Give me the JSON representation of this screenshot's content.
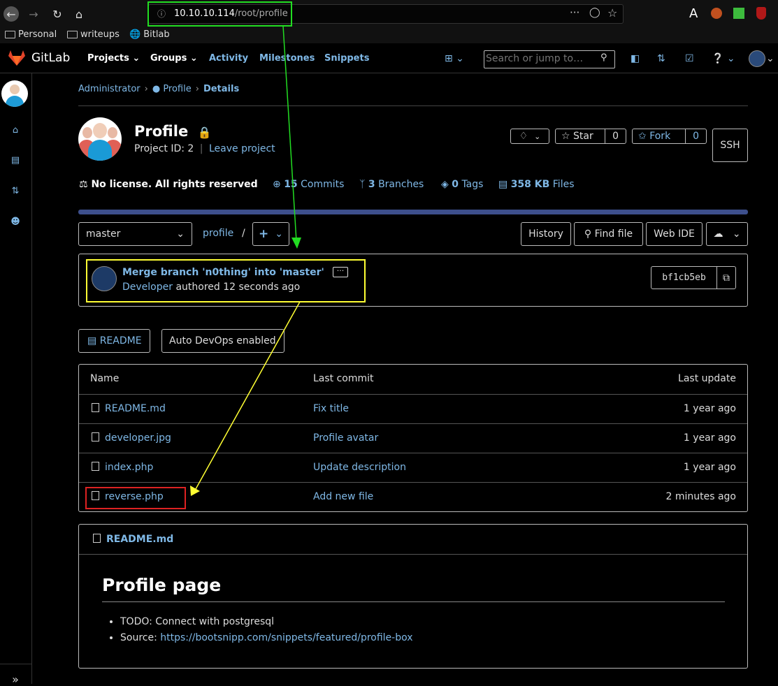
{
  "browser": {
    "url_host": "10.10.10.114",
    "url_path": "/root/profile",
    "bookmarks": [
      "Personal",
      "writeups",
      "Bitlab"
    ],
    "reader_letter": "A"
  },
  "gitlab_header": {
    "brand": "GitLab",
    "nav": [
      "Projects",
      "Groups",
      "Activity",
      "Milestones",
      "Snippets"
    ],
    "search_placeholder": "Search or jump to…"
  },
  "breadcrumb": {
    "items": [
      "Administrator",
      "Profile",
      "Details"
    ]
  },
  "project": {
    "title": "Profile",
    "project_id_label": "Project ID: 2",
    "leave_label": "Leave project",
    "star_label": "Star",
    "star_count": "0",
    "fork_label": "Fork",
    "fork_count": "0",
    "ssh_label": "SSH"
  },
  "stats": {
    "license": "No license. All rights reserved",
    "commits_count": "15",
    "commits_label": "Commits",
    "branches_count": "3",
    "branches_label": "Branches",
    "tags_count": "0",
    "tags_label": "Tags",
    "files_size": "358 KB",
    "files_label": "Files"
  },
  "toolbar": {
    "branch": "master",
    "path": "profile",
    "path_sep": "/",
    "add_label": "+",
    "history": "History",
    "find_file": "Find file",
    "web_ide": "Web IDE"
  },
  "commit": {
    "message": "Merge branch 'n0thing' into 'master'",
    "author": "Developer",
    "authored_text": "authored 12 seconds ago",
    "sha": "bf1cb5eb",
    "ellipsis": "···"
  },
  "pills": {
    "readme": "README",
    "auto_devops": "Auto DevOps enabled"
  },
  "file_table": {
    "headers": [
      "Name",
      "Last commit",
      "Last update"
    ],
    "rows": [
      {
        "name": "README.md",
        "commit": "Fix title",
        "updated": "1 year ago"
      },
      {
        "name": "developer.jpg",
        "commit": "Profile avatar",
        "updated": "1 year ago"
      },
      {
        "name": "index.php",
        "commit": "Update description",
        "updated": "1 year ago"
      },
      {
        "name": "reverse.php",
        "commit": "Add new file",
        "updated": "2 minutes ago"
      }
    ]
  },
  "readme": {
    "filename": "README.md",
    "heading": "Profile page",
    "todo": "TODO: Connect with postgresql",
    "source_label": "Source:",
    "source_link": "https://bootsnipp.com/snippets/featured/profile-box"
  },
  "annotations": {
    "green": "#22dd22",
    "yellow": "#ffff33",
    "red": "#dd2222"
  }
}
